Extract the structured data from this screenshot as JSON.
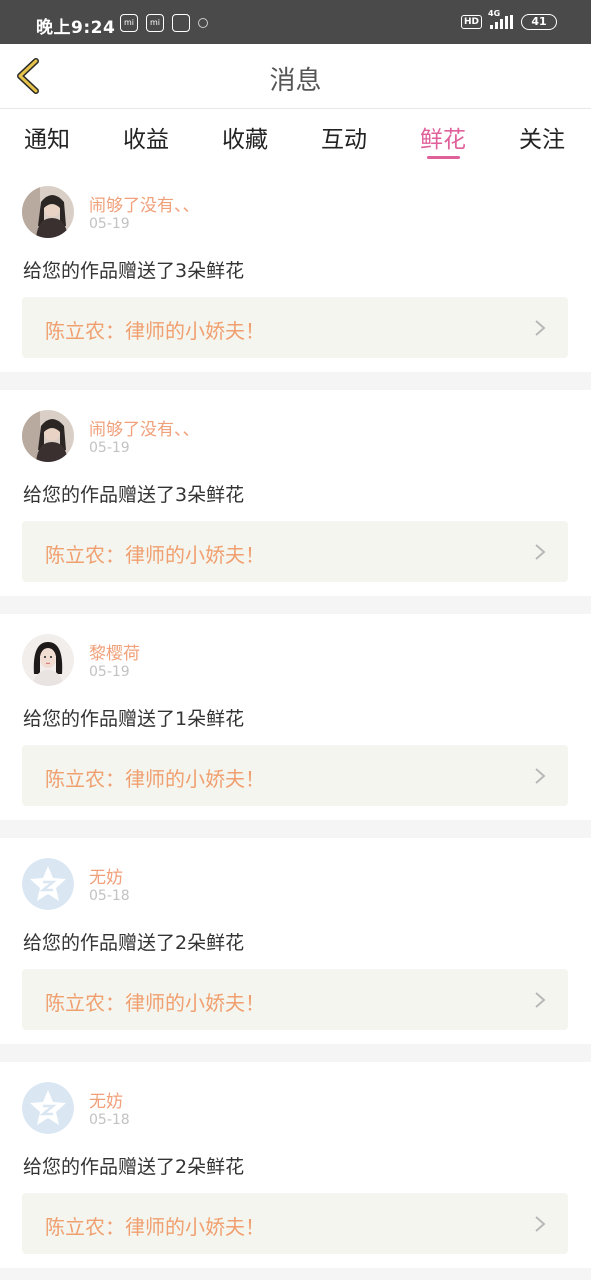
{
  "status_bar": {
    "time": "晚上9:24",
    "icons_left": [
      "mi-icon",
      "mi-icon",
      "file-icon",
      "sync-icon"
    ],
    "hd": "HD",
    "network": "4G",
    "battery": "41"
  },
  "header": {
    "title": "消息"
  },
  "tabs": [
    {
      "label": "通知",
      "active": false
    },
    {
      "label": "收益",
      "active": false
    },
    {
      "label": "收藏",
      "active": false
    },
    {
      "label": "互动",
      "active": false
    },
    {
      "label": "鲜花",
      "active": true
    },
    {
      "label": "关注",
      "active": false
    }
  ],
  "messages": [
    {
      "name": "闹够了没有、、",
      "date": "05-19",
      "text": "给您的作品赠送了3朵鲜花",
      "work": "陈立农：律师的小娇夫！",
      "avatar": "photo-dark-hair"
    },
    {
      "name": "闹够了没有、、",
      "date": "05-19",
      "text": "给您的作品赠送了3朵鲜花",
      "work": "陈立农：律师的小娇夫！",
      "avatar": "photo-dark-hair"
    },
    {
      "name": "黎樱荷",
      "date": "05-19",
      "text": "给您的作品赠送了1朵鲜花",
      "work": "陈立农：律师的小娇夫！",
      "avatar": "photo-portrait"
    },
    {
      "name": "无妨",
      "date": "05-18",
      "text": "给您的作品赠送了2朵鲜花",
      "work": "陈立农：律师的小娇夫！",
      "avatar": "default-star"
    },
    {
      "name": "无妨",
      "date": "05-18",
      "text": "给您的作品赠送了2朵鲜花",
      "work": "陈立农：律师的小娇夫！",
      "avatar": "default-star"
    }
  ],
  "colors": {
    "accent": "#e0609a",
    "name": "#f0a07a",
    "work_title": "#f0a070",
    "work_bg": "#f4f5ee",
    "statusbar_bg": "#4a4a4a",
    "back_icon": "#e6c34a"
  }
}
